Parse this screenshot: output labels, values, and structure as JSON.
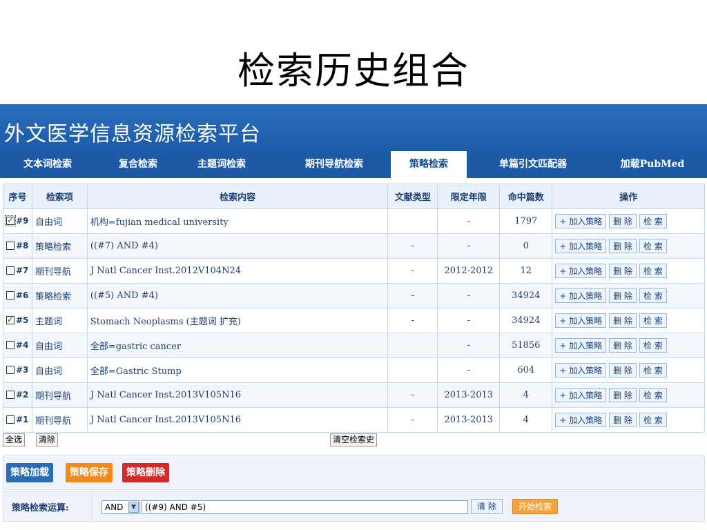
{
  "slide_title": "检索历史组合",
  "banner_title": "外文医学信息资源检索平台",
  "nav": {
    "tabs": [
      {
        "label": "文本词检索"
      },
      {
        "label": "复合检索"
      },
      {
        "label": "主题词检索"
      },
      {
        "label": "期刊导航检索"
      },
      {
        "label": "策略检索"
      },
      {
        "label": "单篇引文匹配器"
      },
      {
        "label": "加载PubMed"
      }
    ],
    "active": "策略检索"
  },
  "table": {
    "headers": [
      "序号",
      "检索项",
      "检索内容",
      "文献类型",
      "限定年限",
      "命中篇数",
      "操作"
    ],
    "rows": [
      {
        "id": "#9",
        "checked": true,
        "field": "自由词",
        "content": "机构=fujian medical university",
        "doc_type": "",
        "years": "-",
        "hits": "1797"
      },
      {
        "id": "#8",
        "checked": false,
        "field": "策略检索",
        "content": "((#7) AND #4)",
        "doc_type": "-",
        "years": "-",
        "hits": "0"
      },
      {
        "id": "#7",
        "checked": false,
        "field": "期刊导航",
        "content": "J Natl Cancer Inst.2012V104N24",
        "doc_type": "-",
        "years": "2012-2012",
        "hits": "12"
      },
      {
        "id": "#6",
        "checked": false,
        "field": "策略检索",
        "content": "((#5) AND #4)",
        "doc_type": "-",
        "years": "-",
        "hits": "34924"
      },
      {
        "id": "#5",
        "checked": true,
        "field": "主题词",
        "content": "Stomach Neoplasms (主题词 扩充)",
        "doc_type": "-",
        "years": "-",
        "hits": "34924"
      },
      {
        "id": "#4",
        "checked": false,
        "field": "自由词",
        "content": "全部=gastric cancer",
        "doc_type": "",
        "years": "-",
        "hits": "51856"
      },
      {
        "id": "#3",
        "checked": false,
        "field": "自由词",
        "content": "全部=Gastric Stump",
        "doc_type": "",
        "years": "-",
        "hits": "604"
      },
      {
        "id": "#2",
        "checked": false,
        "field": "期刊导航",
        "content": "J Natl Cancer Inst.2013V105N16",
        "doc_type": "-",
        "years": "2013-2013",
        "hits": "4"
      },
      {
        "id": "#1",
        "checked": false,
        "field": "期刊导航",
        "content": "J Natl Cancer Inst.2013V105N16",
        "doc_type": "-",
        "years": "2013-2013",
        "hits": "4"
      }
    ],
    "row_actions": {
      "add_label": "+ 加入策略",
      "delete_label": "删 除",
      "search_label": "检 索"
    }
  },
  "below_table": {
    "select_all": "全选",
    "clear": "清除",
    "clear_history": "清空检索史"
  },
  "strategy_buttons": {
    "load": "策略加载",
    "load_color": "#2a6db5",
    "save": "策略保存",
    "save_color": "#f08a1c",
    "delete": "策略删除",
    "delete_color": "#d42a2a"
  },
  "operation": {
    "label": "策略检索运算:",
    "operator": "AND",
    "expression": "((#9) AND #5)",
    "clear_button": "清 除",
    "start_button": "开始检索"
  }
}
